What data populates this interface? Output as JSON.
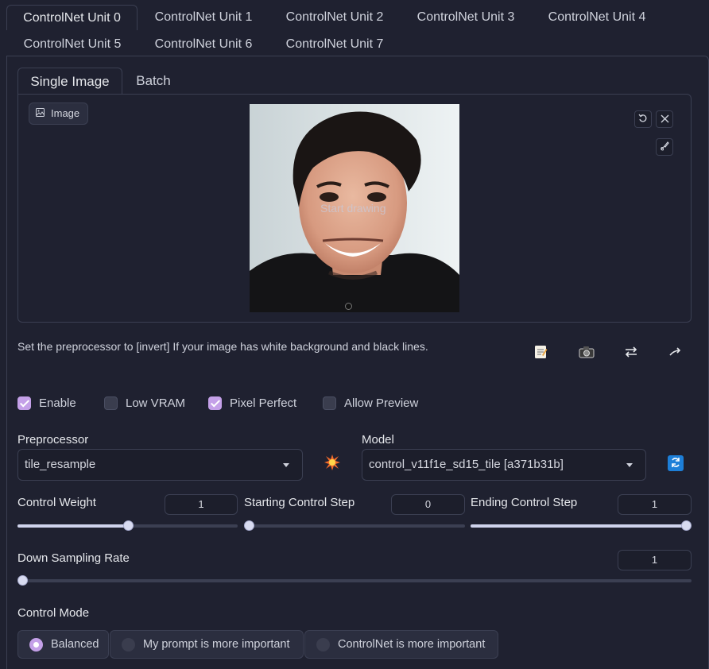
{
  "unit_tabs": [
    {
      "label": "ControlNet Unit 0",
      "active": true
    },
    {
      "label": "ControlNet Unit 1"
    },
    {
      "label": "ControlNet Unit 2"
    },
    {
      "label": "ControlNet Unit 3"
    },
    {
      "label": "ControlNet Unit 4"
    },
    {
      "label": "ControlNet Unit 5"
    },
    {
      "label": "ControlNet Unit 6"
    },
    {
      "label": "ControlNet Unit 7"
    }
  ],
  "input_tabs": [
    {
      "label": "Single Image",
      "active": true
    },
    {
      "label": "Batch"
    }
  ],
  "image_panel": {
    "label": "Image",
    "canvas_hint": "Start drawing"
  },
  "hint_text": "Set the preprocessor to [invert] If your image has white background and black lines.",
  "toolbar_icons": [
    "notes-icon",
    "camera-icon",
    "swap-icon",
    "send-dimensions-icon"
  ],
  "checkboxes": [
    {
      "label": "Enable",
      "checked": true
    },
    {
      "label": "Low VRAM",
      "checked": false
    },
    {
      "label": "Pixel Perfect",
      "checked": true
    },
    {
      "label": "Allow Preview",
      "checked": false
    }
  ],
  "preprocessor": {
    "label": "Preprocessor",
    "value": "tile_resample"
  },
  "model": {
    "label": "Model",
    "value": "control_v11f1e_sd15_tile [a371b31b]"
  },
  "sliders": {
    "control_weight": {
      "label": "Control Weight",
      "value": "1",
      "fraction": 0.5
    },
    "starting_step": {
      "label": "Starting Control Step",
      "value": "0",
      "fraction": 0.0
    },
    "ending_step": {
      "label": "Ending Control Step",
      "value": "1",
      "fraction": 1.0
    },
    "down_sampling": {
      "label": "Down Sampling Rate",
      "value": "1",
      "fraction": 0.0
    }
  },
  "control_mode": {
    "label": "Control Mode",
    "options": [
      {
        "label": "Balanced",
        "selected": true
      },
      {
        "label": "My prompt is more important",
        "selected": false
      },
      {
        "label": "ControlNet is more important",
        "selected": false
      }
    ]
  },
  "colors": {
    "accent": "#c4a0e8",
    "panel": "#1f2130",
    "border": "#3b3f52"
  }
}
